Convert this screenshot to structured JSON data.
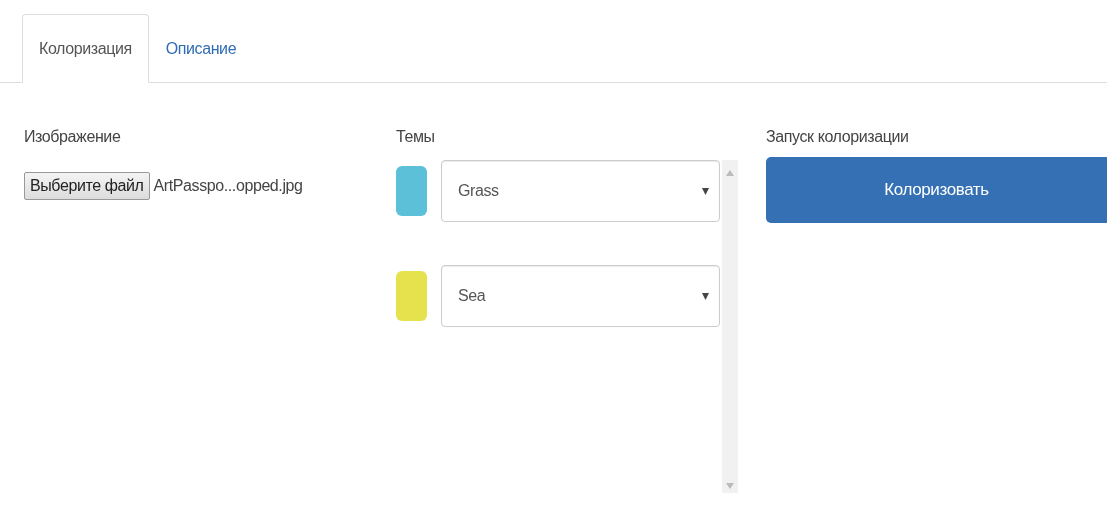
{
  "tabs": [
    {
      "label": "Колоризация",
      "selected": true
    },
    {
      "label": "Описание",
      "selected": false
    }
  ],
  "image": {
    "label": "Изображение",
    "file_button": "Выберите файл",
    "file_name": "ArtPasspo...opped.jpg"
  },
  "themes": {
    "label": "Темы",
    "items": [
      {
        "color": "#5bc0d8",
        "value": "Grass"
      },
      {
        "color": "#e6e24e",
        "value": "Sea"
      }
    ]
  },
  "run": {
    "label": "Запуск колоризации",
    "button": "Колоризовать"
  }
}
